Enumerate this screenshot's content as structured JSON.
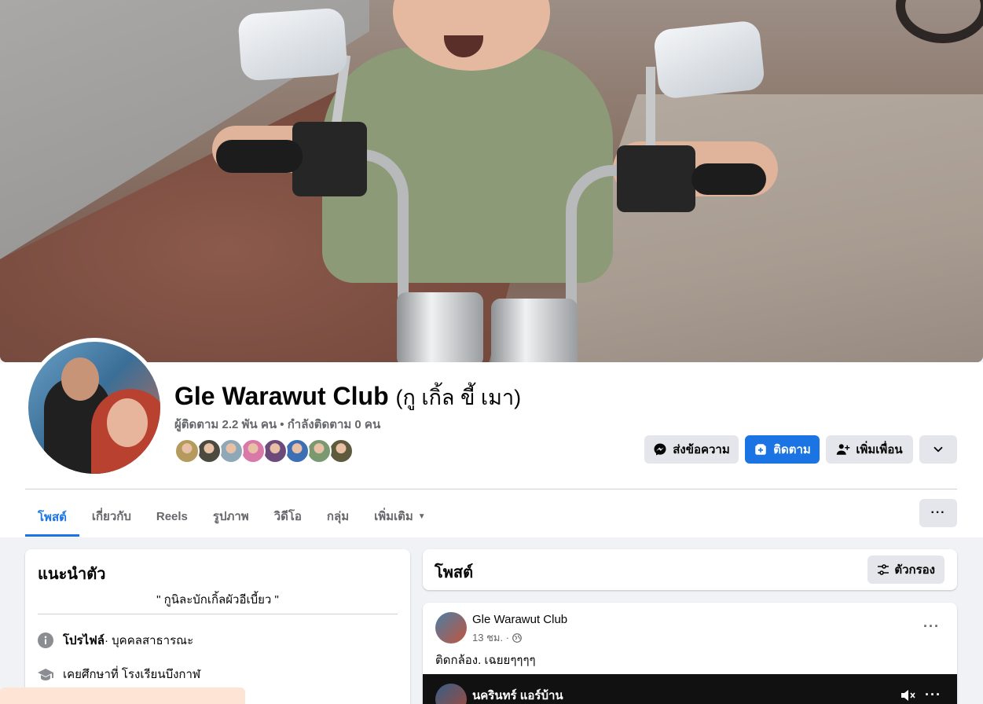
{
  "profile": {
    "name": "Gle Warawut Club",
    "alt_name": "(กู เกิ้ล ขี้ เมา)",
    "stats": "ผู้ติดตาม 2.2 พัน คน • กำลังติดตาม 0 คน",
    "friend_avatar_colors": [
      "#b49a5c",
      "#4c4a3f",
      "#8fa8b7",
      "#d879a7",
      "#6c4a7a",
      "#3d6fb5",
      "#7a9970",
      "#5d5a3d"
    ]
  },
  "actions": {
    "message_label": "ส่งข้อความ",
    "follow_label": "ติดตาม",
    "add_friend_label": "เพิ่มเพื่อน",
    "more_icon": "chevron-down-icon"
  },
  "tabs": [
    {
      "label": "โพสต์"
    },
    {
      "label": "เกี่ยวกับ"
    },
    {
      "label": "Reels"
    },
    {
      "label": "รูปภาพ"
    },
    {
      "label": "วิดีโอ"
    },
    {
      "label": "กลุ่ม"
    },
    {
      "label": "เพิ่มเติม"
    }
  ],
  "intro": {
    "title": "แนะนำตัว",
    "bio": "\" กูนิละบักเกิ้ลผัวอีเบี้ยว \"",
    "profile_label": "โปรไฟล์",
    "profile_value": " · บุคคลสาธารณะ",
    "education": "เคยศึกษาที่ โรงเรียนบึงกาฬ"
  },
  "posts_section": {
    "title": "โพสต์",
    "filter_label": "ตัวกรอง"
  },
  "post": {
    "author": "Gle Warawut Club",
    "time": "13 ชม. ·",
    "text": "ติดกล้อง.  เฉยยๆๆๆๆ",
    "shared_author": "นครินทร์ แอร์บ้าน"
  },
  "colors": {
    "accent": "#1b74e4",
    "background": "#f0f2f5",
    "button_gray": "#e4e6eb",
    "muted_text": "#65676b"
  }
}
